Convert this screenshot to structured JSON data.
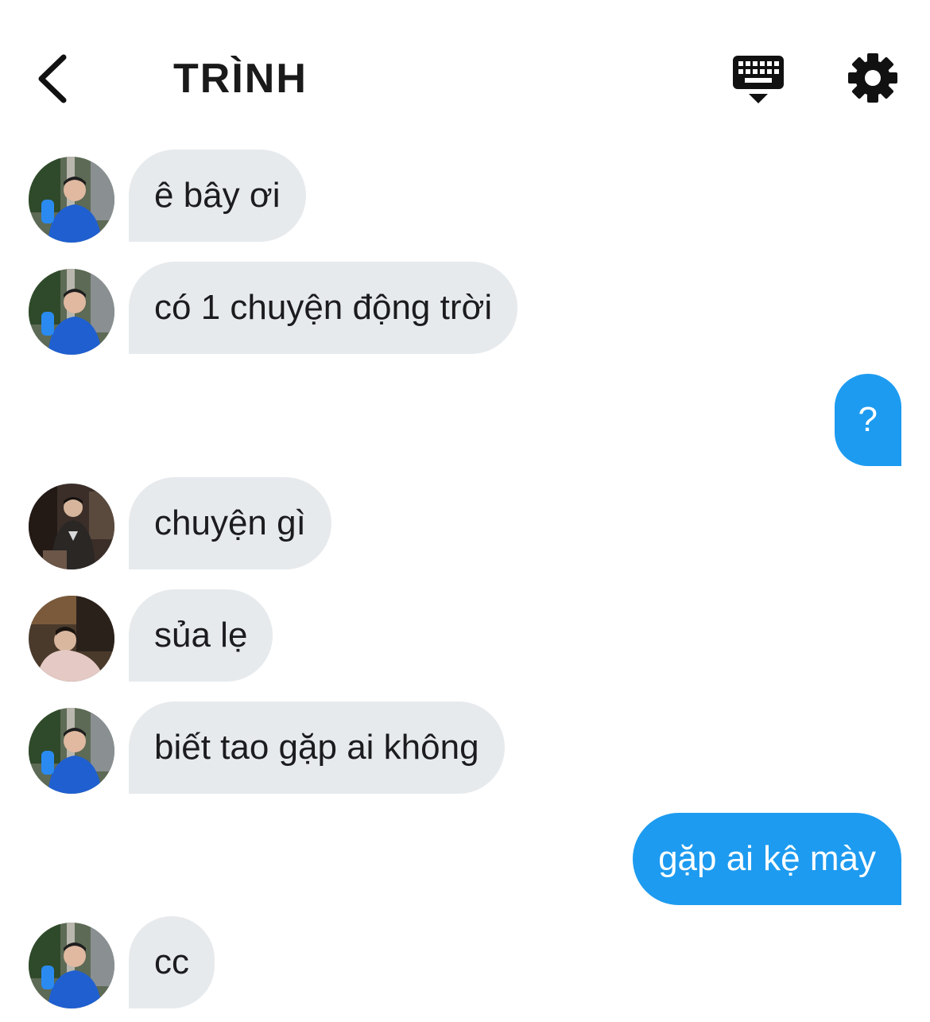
{
  "header": {
    "title": "TRÌNH",
    "back_icon": "chevron-left-icon",
    "keyboard_icon": "keyboard-hide-icon",
    "settings_icon": "gear-icon"
  },
  "colors": {
    "incoming_bubble": "#e7eaed",
    "outgoing_bubble": "#1d9bf0",
    "incoming_text": "#1c1c1e",
    "outgoing_text": "#ffffff"
  },
  "messages": [
    {
      "direction": "in",
      "avatar": "avatar-blue-shirt",
      "text": "ê bây ơi"
    },
    {
      "direction": "in",
      "avatar": "avatar-blue-shirt",
      "text": "có 1 chuyện động trời"
    },
    {
      "direction": "out",
      "text": "?"
    },
    {
      "direction": "in",
      "avatar": "avatar-dark-room",
      "text": "chuyện gì"
    },
    {
      "direction": "in",
      "avatar": "avatar-car-seat",
      "text": "sủa lẹ"
    },
    {
      "direction": "in",
      "avatar": "avatar-blue-shirt",
      "text": "biết tao gặp ai không"
    },
    {
      "direction": "out",
      "text": "gặp ai kệ mày"
    },
    {
      "direction": "in",
      "avatar": "avatar-blue-shirt",
      "text": "cc"
    }
  ]
}
